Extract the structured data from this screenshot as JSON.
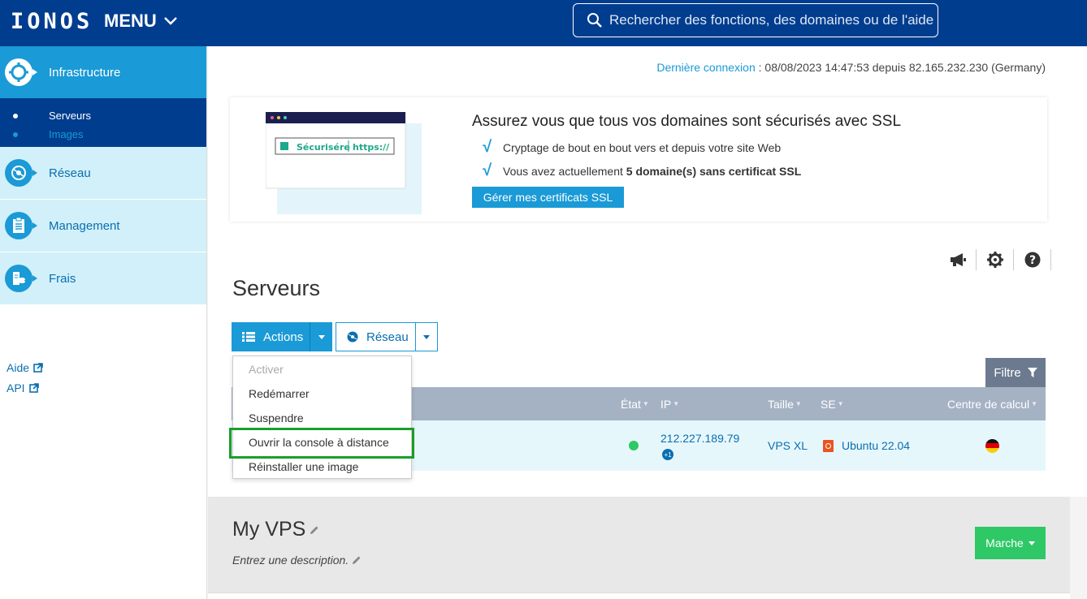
{
  "header": {
    "logo": "IONOS",
    "menu_label": "MENU",
    "search_placeholder": "Rechercher des fonctions, des domaines ou de l'aide"
  },
  "sidebar": {
    "items": [
      {
        "label": "Infrastructure",
        "icon": "infrastructure-icon",
        "active": true
      },
      {
        "label": "Réseau",
        "icon": "network-icon"
      },
      {
        "label": "Management",
        "icon": "clipboard-icon"
      },
      {
        "label": "Frais",
        "icon": "billing-icon"
      }
    ],
    "sub_items": [
      {
        "label": "Serveurs",
        "active": true
      },
      {
        "label": "Images",
        "active": false
      }
    ],
    "links": [
      {
        "label": "Aide"
      },
      {
        "label": "API"
      }
    ]
  },
  "last_login": {
    "label": "Dernière connexion",
    "value": " : 08/08/2023 14:47:53 depuis 82.165.232.230 (Germany)"
  },
  "ssl_banner": {
    "title": "Assurez vous que tous vos domaines sont sécurisés avec SSL",
    "line1": "Cryptage de bout en bout vers et depuis votre site Web",
    "line2_pre": "Vous avez actuellement ",
    "line2_bold": "5 domaine(s) sans certificat SSL",
    "button": "Gérer mes certificats SSL",
    "illus_secure": "Sécurisére",
    "illus_https": "https://"
  },
  "page": {
    "title": "Serveurs"
  },
  "toolbar": {
    "actions_label": "Actions",
    "reseau_label": "Réseau",
    "filter_label": "Filtre"
  },
  "actions_menu": {
    "items": [
      {
        "label": "Activer",
        "disabled": true
      },
      {
        "label": "Redémarrer",
        "disabled": false
      },
      {
        "label": "Suspendre",
        "disabled": false
      },
      {
        "label": "Ouvrir la console à distance",
        "disabled": false
      },
      {
        "label": "Réinstaller une image",
        "disabled": false
      }
    ]
  },
  "table": {
    "columns": [
      "État",
      "IP",
      "Taille",
      "SE",
      "Centre de calcul"
    ],
    "row": {
      "ip": "212.227.189.79",
      "ip_extra": "+1",
      "size": "VPS XL",
      "os": "Ubuntu 22.04",
      "status_color": "#2ec866"
    }
  },
  "server_detail": {
    "name": "My VPS",
    "description_placeholder": "Entrez une description.",
    "state_button": "Marche"
  },
  "colors": {
    "brand": "#003d8f",
    "accent": "#1a9ad6",
    "success": "#2ec866",
    "highlight": "#1a9e2a"
  }
}
